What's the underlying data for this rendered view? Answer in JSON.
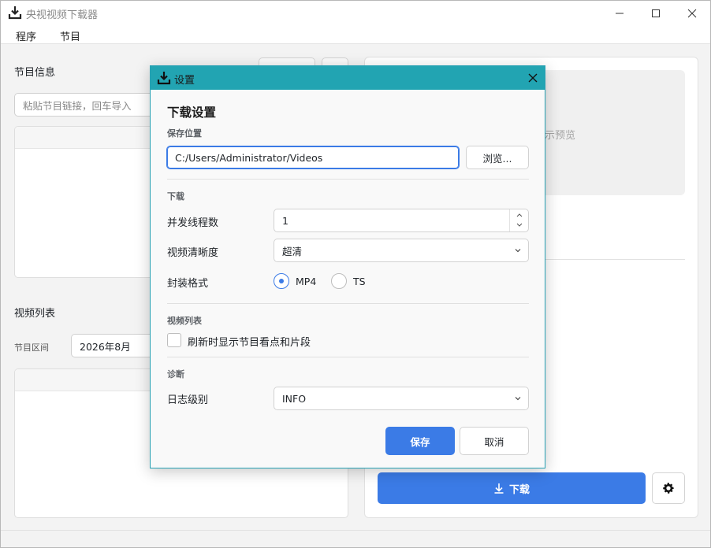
{
  "window": {
    "title": "央视视频下载器"
  },
  "menubar": {
    "items": [
      "程序",
      "节目"
    ]
  },
  "left_panel": {
    "program_info_label": "节目信息",
    "link_input_placeholder": "粘贴节目链接，回车导入",
    "video_list_label": "视频列表",
    "range_label": "节目区间",
    "range_value": "2026年8月"
  },
  "right_panel": {
    "preview_hint": "示预览",
    "download_label": "下载"
  },
  "dialog": {
    "title": "设置",
    "heading": "下载设置",
    "save_location": {
      "section_label": "保存位置",
      "path_value": "C:/Users/Administrator/Videos",
      "browse_label": "浏览..."
    },
    "download": {
      "section_label": "下载",
      "threads_label": "并发线程数",
      "threads_value": "1",
      "quality_label": "视频清晰度",
      "quality_value": "超清",
      "format_label": "封装格式",
      "format_options": [
        "MP4",
        "TS"
      ],
      "format_selected": "MP4"
    },
    "video_list": {
      "section_label": "视频列表",
      "refresh_checkbox_label": "刷新时显示节目看点和片段",
      "refresh_checked": false
    },
    "diagnostics": {
      "section_label": "诊断",
      "log_level_label": "日志级别",
      "log_level_value": "INFO"
    },
    "save_label": "保存",
    "cancel_label": "取消"
  },
  "colors": {
    "accent": "#3b7be6",
    "dialog_titlebar": "#22a4b2"
  }
}
